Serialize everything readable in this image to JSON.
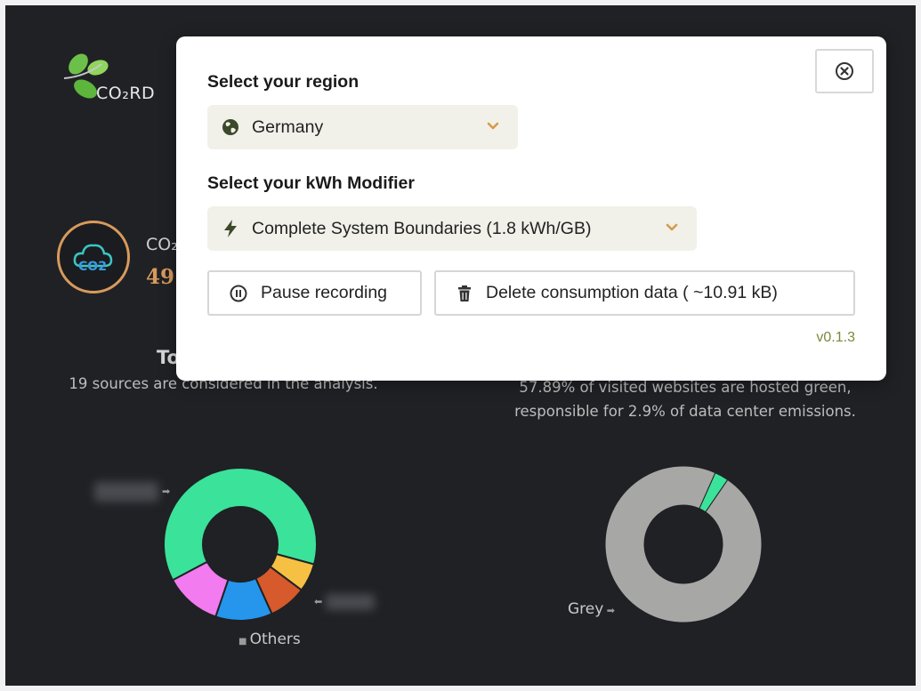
{
  "app": {
    "logo_text": "CO₂RD",
    "co2_title": "CO₂",
    "co2_value": "49.",
    "left_heading": "To",
    "left_subtitle": "19 sources are considered in the analysis.",
    "right_subtitle_line1": "57.89% of visited websites are hosted green,",
    "right_subtitle_line2": "responsible for 2.9% of data center emissions.",
    "colors": {
      "background": "#202125",
      "accent": "#d89a5c",
      "green_slice": "#3be29a",
      "grey_slice": "#a7a7a5"
    }
  },
  "settings_modal": {
    "region_label": "Select your region",
    "region_value": "Germany",
    "region_icon": "globe-icon",
    "kwh_label": "Select your kWh Modifier",
    "kwh_value": "Complete System Boundaries (1.8 kWh/GB)",
    "kwh_icon": "lightning-icon",
    "pause_label": "Pause recording",
    "delete_label": "Delete consumption data ( ~10.91 kB)",
    "version": "v0.1.3",
    "close_icon": "close-icon"
  },
  "chart_data": [
    {
      "type": "pie",
      "title": "",
      "labels": [
        "",
        "",
        "",
        "",
        "Others"
      ],
      "values": [
        62,
        6,
        8,
        12,
        12
      ],
      "colors": [
        "#3be29a",
        "#f6c143",
        "#d65a2b",
        "#2596ec",
        "#f27bf0"
      ]
    },
    {
      "type": "pie",
      "title": "",
      "labels": [
        "",
        "Grey"
      ],
      "values": [
        2.9,
        97.1
      ],
      "colors": [
        "#3be29a",
        "#a7a7a5"
      ]
    }
  ]
}
